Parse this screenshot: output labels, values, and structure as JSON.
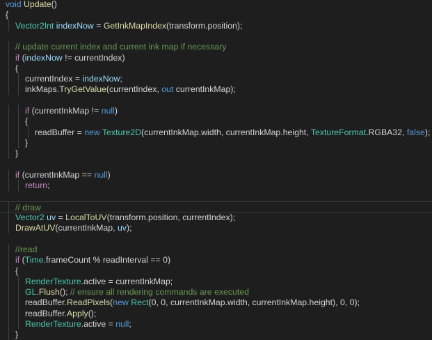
{
  "colors": {
    "background": "#1e1e1e",
    "keyword": "#569cd6",
    "control": "#c586c0",
    "type": "#4ec9b0",
    "method": "#dcdcaa",
    "variable": "#9cdcfe",
    "comment": "#6a9955",
    "number": "#b5cea8",
    "plain": "#d4d4d4",
    "indent_guide": "#404040"
  },
  "lines": [
    {
      "indent": 0,
      "tokens": [
        [
          "void",
          "keyword"
        ],
        [
          " ",
          "plain"
        ],
        [
          "Update",
          "method"
        ],
        [
          "()",
          "plain"
        ]
      ]
    },
    {
      "indent": 0,
      "tokens": [
        [
          "{",
          "plain"
        ]
      ]
    },
    {
      "indent": 1,
      "tokens": [
        [
          "Vector2Int",
          "type"
        ],
        [
          " ",
          "plain"
        ],
        [
          "indexNow",
          "variable"
        ],
        [
          " = ",
          "plain"
        ],
        [
          "GetInkMapIndex",
          "method"
        ],
        [
          "(transform.position);",
          "plain"
        ]
      ]
    },
    {
      "indent": 0,
      "tokens": []
    },
    {
      "indent": 1,
      "tokens": [
        [
          "// update current index and current ink map if necessary",
          "comment"
        ]
      ]
    },
    {
      "indent": 1,
      "tokens": [
        [
          "if",
          "control"
        ],
        [
          " (",
          "plain"
        ],
        [
          "indexNow",
          "variable"
        ],
        [
          " != currentIndex)",
          "plain"
        ]
      ]
    },
    {
      "indent": 1,
      "tokens": [
        [
          "{",
          "plain"
        ]
      ]
    },
    {
      "indent": 2,
      "tokens": [
        [
          "currentIndex = ",
          "plain"
        ],
        [
          "indexNow",
          "variable"
        ],
        [
          ";",
          "plain"
        ]
      ]
    },
    {
      "indent": 2,
      "tokens": [
        [
          "inkMaps.",
          "plain"
        ],
        [
          "TryGetValue",
          "method"
        ],
        [
          "(currentIndex, ",
          "plain"
        ],
        [
          "out",
          "keyword"
        ],
        [
          " currentInkMap);",
          "plain"
        ]
      ]
    },
    {
      "indent": 0,
      "tokens": []
    },
    {
      "indent": 2,
      "tokens": [
        [
          "if",
          "control"
        ],
        [
          " (currentInkMap != ",
          "plain"
        ],
        [
          "null",
          "keyword"
        ],
        [
          ")",
          "plain"
        ]
      ]
    },
    {
      "indent": 2,
      "tokens": [
        [
          "{",
          "plain"
        ]
      ]
    },
    {
      "indent": 3,
      "tokens": [
        [
          "readBuffer = ",
          "plain"
        ],
        [
          "new",
          "keyword"
        ],
        [
          " ",
          "plain"
        ],
        [
          "Texture2D",
          "type"
        ],
        [
          "(currentInkMap.width, currentInkMap.height, ",
          "plain"
        ],
        [
          "TextureFormat",
          "type"
        ],
        [
          ".RGBA32, ",
          "plain"
        ],
        [
          "false",
          "keyword"
        ],
        [
          ");",
          "plain"
        ]
      ]
    },
    {
      "indent": 2,
      "tokens": [
        [
          "}",
          "plain"
        ]
      ]
    },
    {
      "indent": 1,
      "tokens": [
        [
          "}",
          "plain"
        ]
      ]
    },
    {
      "indent": 0,
      "tokens": []
    },
    {
      "indent": 1,
      "tokens": [
        [
          "if",
          "control"
        ],
        [
          " (currentInkMap == ",
          "plain"
        ],
        [
          "null",
          "keyword"
        ],
        [
          ")",
          "plain"
        ]
      ]
    },
    {
      "indent": 2,
      "tokens": [
        [
          "return",
          "control"
        ],
        [
          ";",
          "plain"
        ]
      ]
    },
    {
      "indent": 0,
      "tokens": []
    },
    {
      "indent": 1,
      "highlight": true,
      "tokens": [
        [
          "// draw",
          "comment"
        ]
      ]
    },
    {
      "indent": 1,
      "tokens": [
        [
          "Vector2",
          "type"
        ],
        [
          " ",
          "plain"
        ],
        [
          "uv",
          "variable"
        ],
        [
          " = ",
          "plain"
        ],
        [
          "LocalToUV",
          "method"
        ],
        [
          "(transform.position, currentIndex);",
          "plain"
        ]
      ]
    },
    {
      "indent": 1,
      "tokens": [
        [
          "DrawAtUV",
          "method"
        ],
        [
          "(currentInkMap, ",
          "plain"
        ],
        [
          "uv",
          "variable"
        ],
        [
          ");",
          "plain"
        ]
      ]
    },
    {
      "indent": 0,
      "tokens": []
    },
    {
      "indent": 1,
      "tokens": [
        [
          "//read",
          "comment"
        ]
      ]
    },
    {
      "indent": 1,
      "tokens": [
        [
          "if",
          "control"
        ],
        [
          " (",
          "plain"
        ],
        [
          "Time",
          "type"
        ],
        [
          ".frameCount % readInterval == 0)",
          "plain"
        ]
      ]
    },
    {
      "indent": 1,
      "tokens": [
        [
          "{",
          "plain"
        ]
      ]
    },
    {
      "indent": 2,
      "tokens": [
        [
          "RenderTexture",
          "type"
        ],
        [
          ".active = currentInkMap;",
          "plain"
        ]
      ]
    },
    {
      "indent": 2,
      "tokens": [
        [
          "GL",
          "type"
        ],
        [
          ".",
          "plain"
        ],
        [
          "Flush",
          "method"
        ],
        [
          "(); ",
          "plain"
        ],
        [
          "// ensure all rendering commands are executed",
          "comment"
        ]
      ]
    },
    {
      "indent": 2,
      "tokens": [
        [
          "readBuffer.",
          "plain"
        ],
        [
          "ReadPixels",
          "method"
        ],
        [
          "(",
          "plain"
        ],
        [
          "new",
          "keyword"
        ],
        [
          " ",
          "plain"
        ],
        [
          "Rect",
          "type"
        ],
        [
          "(0, 0, currentInkMap.width, currentInkMap.height), 0, 0);",
          "plain"
        ]
      ]
    },
    {
      "indent": 2,
      "tokens": [
        [
          "readBuffer.",
          "plain"
        ],
        [
          "Apply",
          "method"
        ],
        [
          "();",
          "plain"
        ]
      ]
    },
    {
      "indent": 2,
      "tokens": [
        [
          "RenderTexture",
          "type"
        ],
        [
          ".active = ",
          "plain"
        ],
        [
          "null",
          "keyword"
        ],
        [
          ";",
          "plain"
        ]
      ]
    },
    {
      "indent": 1,
      "tokens": [
        [
          "}",
          "plain"
        ]
      ]
    }
  ]
}
